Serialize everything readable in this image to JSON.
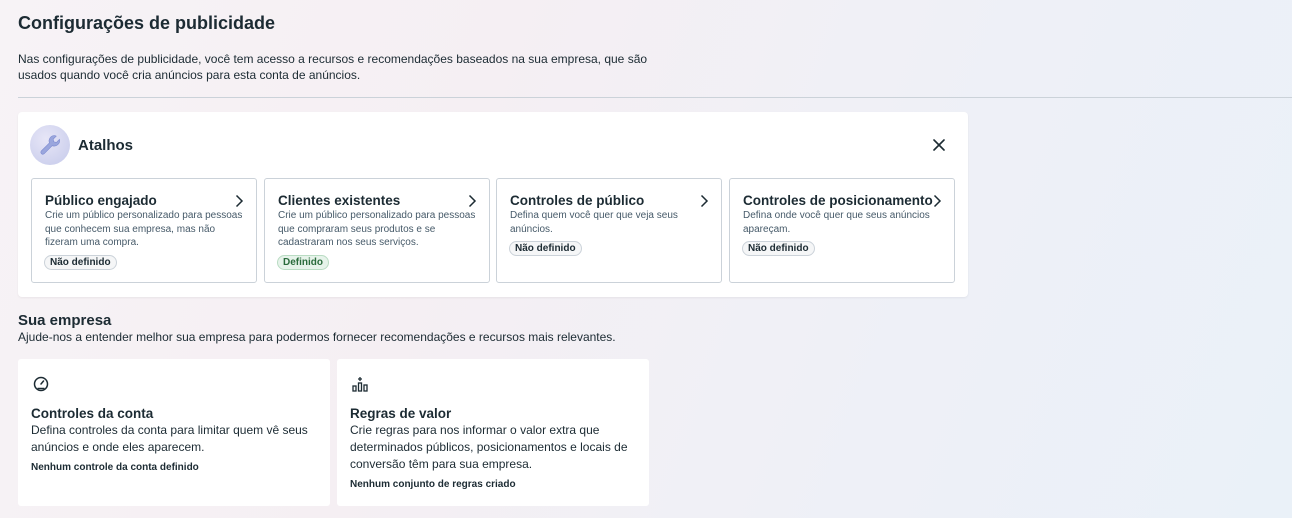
{
  "header": {
    "title": "Configurações de publicidade",
    "description": "Nas configurações de publicidade, você tem acesso a recursos e recomendações baseados na sua empresa, que são usados quando você cria anúncios para esta conta de anúncios."
  },
  "shortcuts": {
    "title": "Atalhos",
    "icon": "wrench-icon",
    "close_icon": "close-icon",
    "cards": [
      {
        "title": "Público engajado",
        "description": "Crie um público personalizado para pessoas que conhecem sua empresa, mas não fizeram uma compra.",
        "status": "Não definido"
      },
      {
        "title": "Clientes existentes",
        "description": "Crie um público personalizado para pessoas que compraram seus produtos e se cadastraram nos seus serviços.",
        "status": "Definido"
      },
      {
        "title": "Controles de público",
        "description": "Defina quem você quer que veja seus anúncios.",
        "status": "Não definido"
      },
      {
        "title": "Controles de posicionamento",
        "description": "Defina onde você quer que seus anúncios apareçam.",
        "status": "Não definido"
      }
    ]
  },
  "company": {
    "title": "Sua empresa",
    "description": "Ajude-nos a entender melhor sua empresa para podermos fornecer recomendações e recursos mais relevantes.",
    "cards": [
      {
        "icon": "gauge-icon",
        "title": "Controles da conta",
        "description": "Defina controles da conta para limitar quem vê seus anúncios e onde eles aparecem.",
        "status": "Nenhum controle da conta definido"
      },
      {
        "icon": "value-rules-icon",
        "title": "Regras de valor",
        "description": "Crie regras para nos informar o valor extra que determinados públicos, posicionamentos e locais de conversão têm para sua empresa.",
        "status": "Nenhum conjunto de regras criado"
      }
    ]
  },
  "colors": {
    "text_primary": "#1c2b33",
    "text_secondary": "#465a69",
    "border": "#cbd2d9",
    "badge_defined_bg": "#e6f3ea",
    "badge_defined_text": "#2a6b3c"
  }
}
